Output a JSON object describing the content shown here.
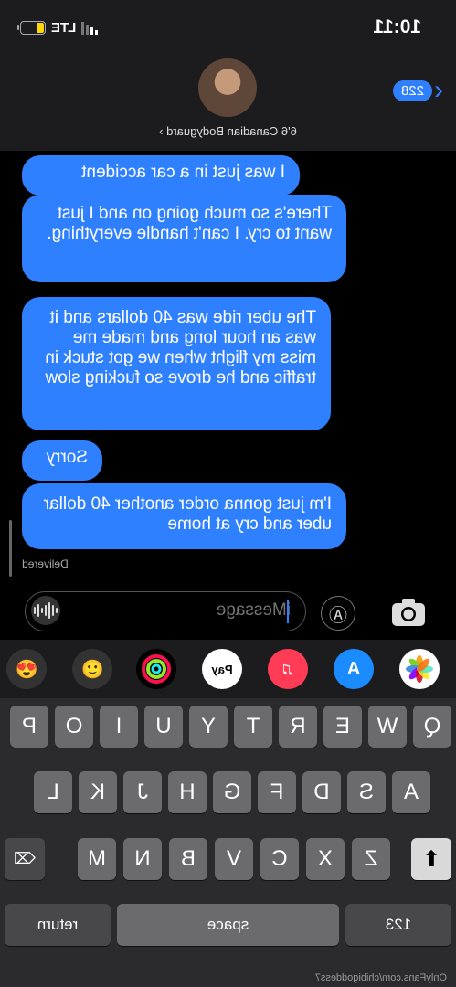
{
  "status": {
    "time": "10:11",
    "network": "LTE",
    "battery_level": 0.35,
    "battery_color": "#ffd60a"
  },
  "header": {
    "back_count": "228",
    "contact_name": "6'6 Canadian Bodyguard ›"
  },
  "messages": [
    "I was just in a car accident",
    "There's so much going on and I just want to cry. I can't handle everything.",
    "The uber ride was 40 dollars and it was an hour long and made me miss my flight when we got stuck in traffic and he drove so fucking slow",
    "Sorry",
    "I'm just gonna order another 40 dollar uber and cry at home"
  ],
  "delivered_label": "Delivered",
  "composer": {
    "placeholder": "iMessage"
  },
  "apps": [
    "photos-icon",
    "appstore-icon",
    "music-icon",
    "applepay-icon",
    "activity-icon",
    "memoji-icon",
    "emoji-stickers-icon"
  ],
  "applepay_label": "Pay",
  "keyboard": {
    "row1": [
      "Q",
      "W",
      "E",
      "R",
      "T",
      "Y",
      "U",
      "I",
      "O",
      "P"
    ],
    "row2": [
      "A",
      "S",
      "D",
      "F",
      "G",
      "H",
      "J",
      "K",
      "L"
    ],
    "row3": [
      "Z",
      "X",
      "C",
      "V",
      "B",
      "N",
      "M"
    ],
    "numbers_label": "123",
    "space_label": "space",
    "return_label": "return"
  },
  "watermark": "OnlyFans.com/chibigoddess7",
  "accent_color": "#2f80ff"
}
